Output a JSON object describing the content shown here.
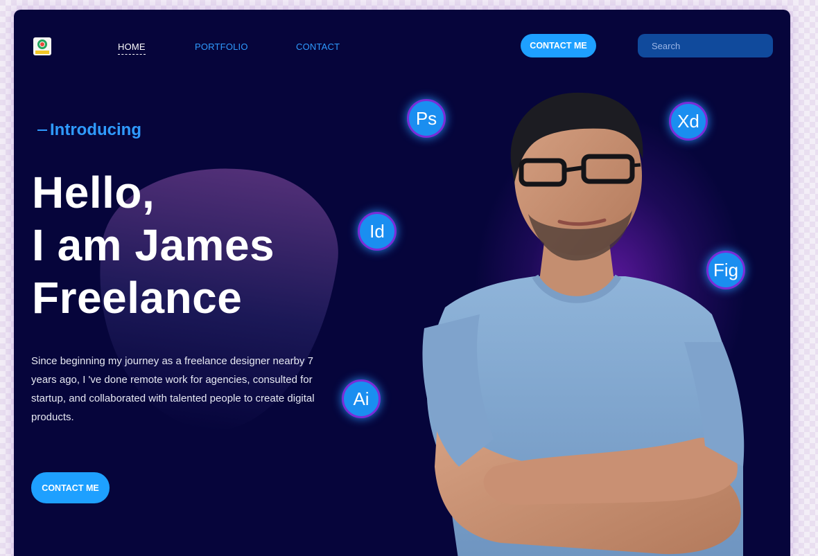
{
  "nav": {
    "logo_name": "logo-icon",
    "links": [
      {
        "label": "HOME",
        "active": true
      },
      {
        "label": "PORTFOLIO",
        "active": false
      },
      {
        "label": "CONTACT",
        "active": false
      }
    ],
    "contact_button": "CONTACT ME",
    "search_placeholder": "Search"
  },
  "hero": {
    "intro": "Introducing",
    "headline": [
      "Hello,",
      "I am James",
      "Freelance"
    ],
    "description": "Since beginning my journey as a freelance designer nearby 7 years ago, I 've done remote work for agencies, consulted for startup, and collaborated with talented people to create digital products.",
    "cta": "CONTACT ME"
  },
  "tools": [
    "Ps",
    "Xd",
    "Id",
    "Fig",
    "Ai"
  ],
  "colors": {
    "background": "#06053b",
    "accent": "#1ea0ff",
    "link": "#2f9bff",
    "glow": "#7a2cd6"
  }
}
